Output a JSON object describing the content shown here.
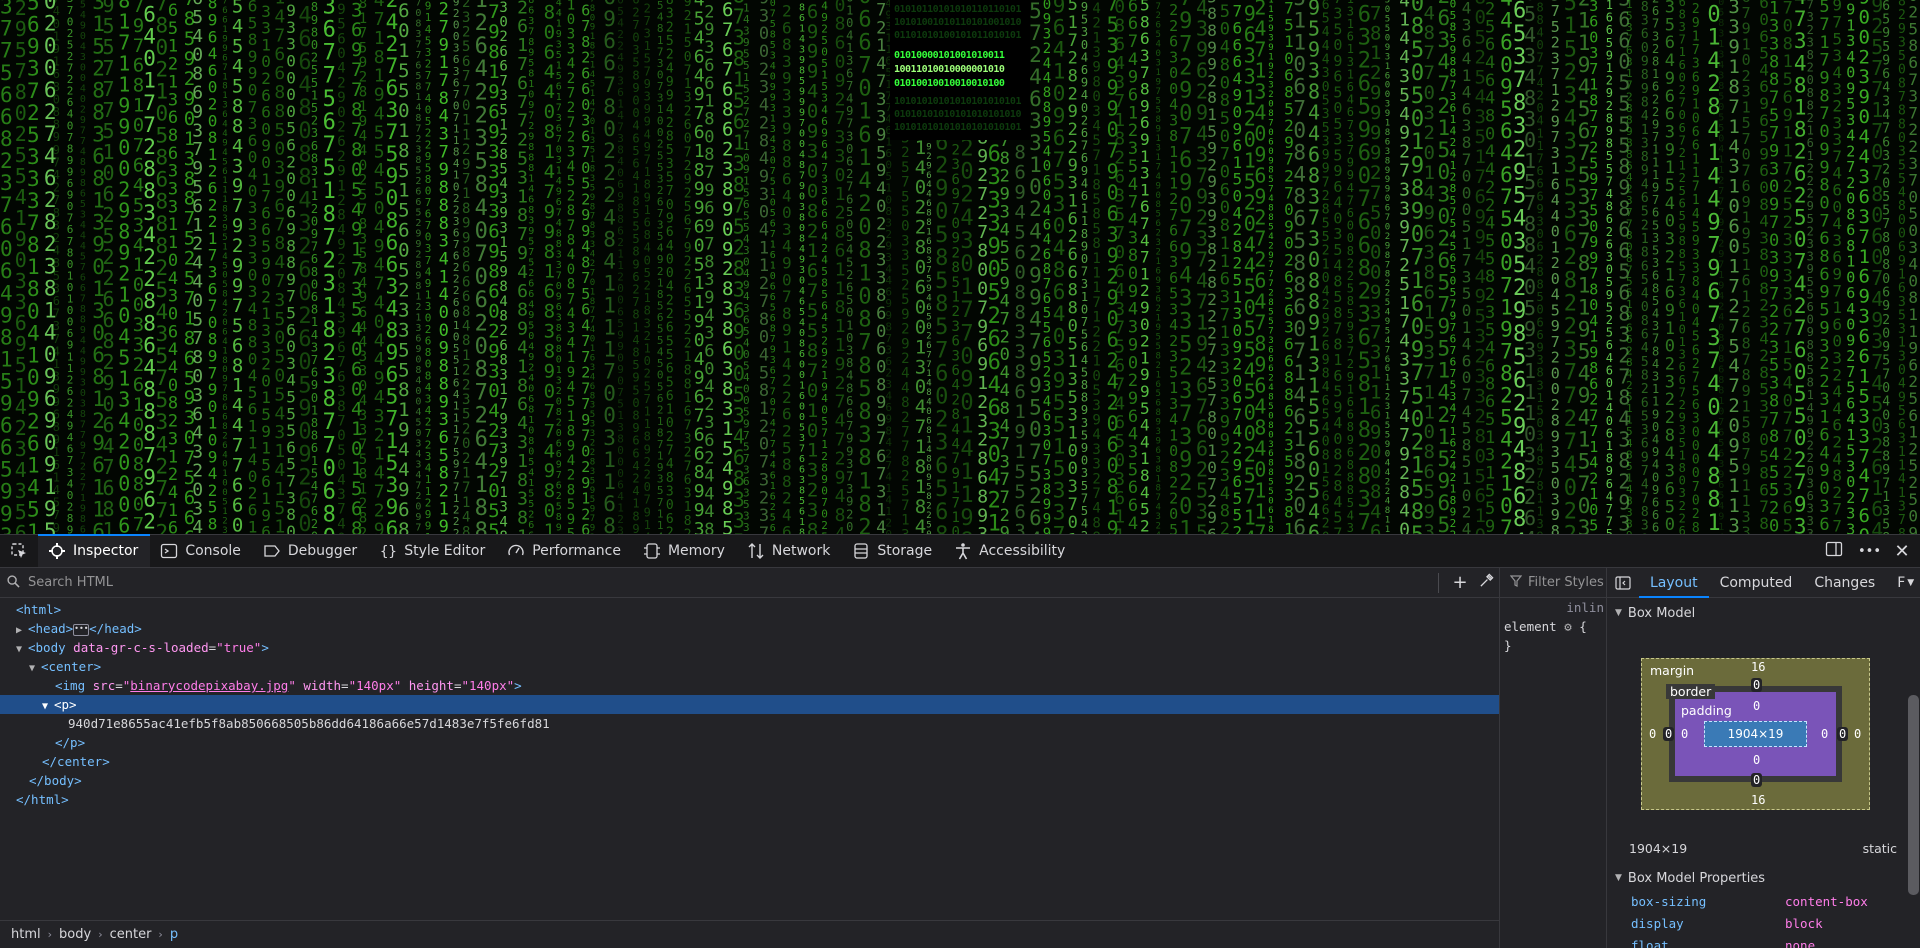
{
  "viewport": {
    "image": {
      "rows_dim_top": [
        "01010110101010110110101",
        "10101001010110101001010",
        "01101010100101011010101"
      ],
      "rows_bright": [
        "01010000101001010011",
        "10011010010000001010",
        "01010010010010010100"
      ],
      "rows_dim_bottom": [
        "10101010101010101010101",
        "01010101010101010101010",
        "10101010101010101010101"
      ]
    }
  },
  "toolbar": {
    "tabs": [
      {
        "label": "Inspector",
        "icon": "inspector-icon"
      },
      {
        "label": "Console",
        "icon": "console-icon"
      },
      {
        "label": "Debugger",
        "icon": "debugger-icon"
      },
      {
        "label": "Style Editor",
        "icon": "style-editor-icon"
      },
      {
        "label": "Performance",
        "icon": "performance-icon"
      },
      {
        "label": "Memory",
        "icon": "memory-icon"
      },
      {
        "label": "Network",
        "icon": "network-icon"
      },
      {
        "label": "Storage",
        "icon": "storage-icon"
      },
      {
        "label": "Accessibility",
        "icon": "accessibility-icon"
      }
    ],
    "overflow": "•••",
    "close": "✕"
  },
  "markup": {
    "search_placeholder": "Search HTML",
    "nodes": {
      "html_open": "<html>",
      "head_open": "<head>",
      "head_close": "</head>",
      "body_tag": "<body",
      "body_attr_name": "data-gr-c-s-loaded",
      "body_attr_val": "\"true\"",
      "gt": ">",
      "center_open": "<center>",
      "img_tag": "<img",
      "img_src_name": "src",
      "img_src_q": "\"",
      "img_src_val": "binarycodepixabay.jpg",
      "img_w_name": "width",
      "img_w_val": "\"140px\"",
      "img_h_name": "height",
      "img_h_val": "\"140px\"",
      "p_open": "<p>",
      "p_text": "940d71e8655ac41efb5f8ab850668505b86dd64186a66e57d1483e7f5fe6fd81",
      "p_close": "</p>",
      "center_close": "</center>",
      "body_close": "</body>",
      "html_close": "</html>"
    },
    "breadcrumbs": [
      "html",
      "body",
      "center",
      "p"
    ]
  },
  "rules": {
    "filter_placeholder": "Filter Styles",
    "inline": "inlin",
    "element": "element",
    "brace_open": "{",
    "brace_close": "}"
  },
  "sidebar": {
    "tabs": [
      "Layout",
      "Computed",
      "Changes",
      "F"
    ],
    "box_model_title": "Box Model",
    "box": {
      "margin_label": "margin",
      "border_label": "border",
      "padding_label": "padding",
      "content": "1904×19",
      "margin_top": "16",
      "margin_bottom": "16",
      "margin_left": "0",
      "margin_right": "0",
      "border_top": "0",
      "border_bottom": "0",
      "border_left": "0",
      "border_right": "0",
      "padding_top": "0",
      "padding_bottom": "0",
      "padding_left": "0",
      "padding_right": "0"
    },
    "dimensions": "1904×19",
    "position": "static",
    "props_title": "Box Model Properties",
    "props": [
      {
        "k": "box-sizing",
        "v": "content-box"
      },
      {
        "k": "display",
        "v": "block"
      },
      {
        "k": "float",
        "v": "none"
      }
    ]
  }
}
